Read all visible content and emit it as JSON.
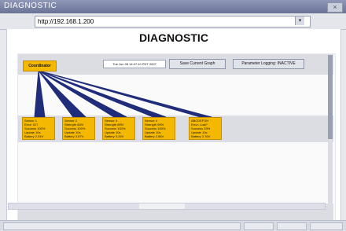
{
  "window": {
    "title": "DIAGNOSTIC",
    "close_glyph": "×"
  },
  "address_bar": {
    "url": "http://192.168.1.200",
    "dropdown_glyph": "▾"
  },
  "page": {
    "title": "DIAGNOSTIC"
  },
  "toolbar": {
    "timestamp": "Tue Jun 05 14:47:10 PDT 2007",
    "save_label": "Save Current Graph",
    "logging_label": "Parameter Logging: INACTIVE"
  },
  "coordinator": {
    "label": "Coordinator",
    "color": "#f5b800"
  },
  "sensors": [
    {
      "lines": [
        "Sensor 1",
        "Error: ID?",
        "Success 100%",
        "Update 10s",
        "Battery 2.94V"
      ]
    },
    {
      "lines": [
        "Sensor 2",
        "Strength 84%",
        "Success 100%",
        "Update 10s",
        "Battery 3.87V"
      ]
    },
    {
      "lines": [
        "Sensor 3",
        "Strength 85%",
        "Success 100%",
        "Update 10s",
        "Battery 3.25V"
      ]
    },
    {
      "lines": [
        "Sensor 4",
        "Strength 90%",
        "Success 100%",
        "Update 10s",
        "Battery 2.86V"
      ]
    },
    {
      "lines": [
        "ABCDEFGH",
        "Error: Lost?",
        "Success 33%",
        "Update 10s",
        "Battery 3.76V"
      ]
    }
  ],
  "colors": {
    "link_line": "#1f2d7a",
    "node_fill": "#f5b800"
  }
}
